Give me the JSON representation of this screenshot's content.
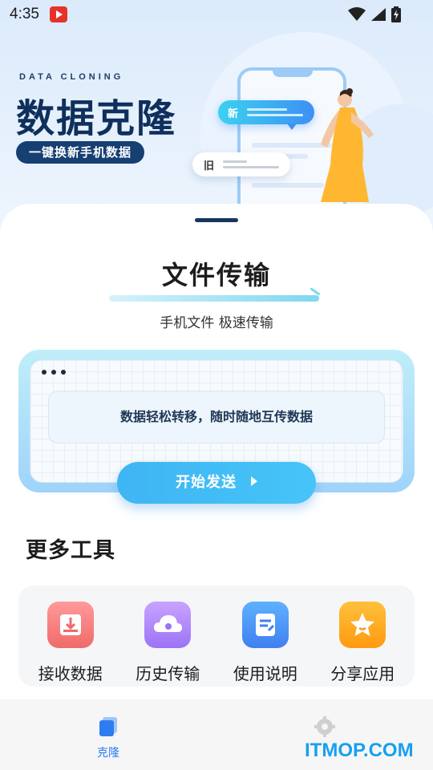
{
  "status_bar": {
    "time": "4:35"
  },
  "hero": {
    "eyebrow": "DATA CLONING",
    "title": "数据克隆",
    "subtitle_pill": "一键换新手机数据",
    "bubble_new_label": "新",
    "bubble_old_label": "旧"
  },
  "transfer": {
    "title": "文件传输",
    "subtitle": "手机文件 极速传输",
    "message": "数据轻松转移，随时随地互传数据",
    "send_button": "开始发送"
  },
  "more_tools": {
    "title": "更多工具",
    "items": [
      {
        "label": "接收数据",
        "icon": "receive-icon",
        "color": "#f06a6a"
      },
      {
        "label": "历史传输",
        "icon": "cloud-history-icon",
        "color": "#9c73f5"
      },
      {
        "label": "使用说明",
        "icon": "document-icon",
        "color": "#3f7ff0"
      },
      {
        "label": "分享应用",
        "icon": "star-share-icon",
        "color": "#ff9a10"
      }
    ]
  },
  "bottom_nav": {
    "items": [
      {
        "label": "克隆",
        "icon": "clone-icon",
        "active": true
      },
      {
        "label": "",
        "icon": "gear-icon",
        "active": false
      }
    ]
  },
  "watermark": "ITMOP.COM",
  "colors": {
    "accent": "#2e7df0",
    "hero_dark": "#0f2f5c"
  }
}
